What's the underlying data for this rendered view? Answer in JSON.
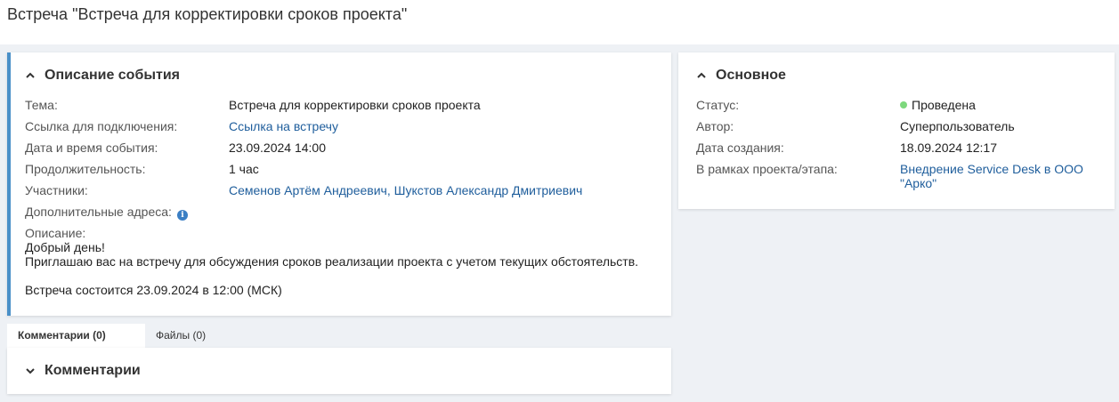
{
  "page": {
    "title": "Встреча \"Встреча для корректировки сроков проекта\""
  },
  "event_card": {
    "header": "Описание события",
    "fields": {
      "topic_label": "Тема:",
      "topic_value": "Встреча для корректировки сроков проекта",
      "link_label": "Ссылка для подключения:",
      "link_value": "Ссылка на встречу",
      "datetime_label": "Дата и время события:",
      "datetime_value": "23.09.2024 14:00",
      "duration_label": "Продолжительность:",
      "duration_value": "1 час",
      "participants_label": "Участники:",
      "participant_1": "Семенов Артём Андреевич",
      "participant_sep": ", ",
      "participant_2": "Шукстов Александр Дмитриевич",
      "extra_addresses_label": "Дополнительные адреса:",
      "description_label": "Описание:"
    },
    "description_lines": [
      "Добрый день!",
      "Приглашаю вас на встречу для обсуждения сроков реализации проекта с учетом текущих обстоятельств.",
      "Встреча состоится 23.09.2024 в 12:00 (МСК)"
    ]
  },
  "main_card": {
    "header": "Основное",
    "status_label": "Статус:",
    "status_value": "Проведена",
    "status_color": "#7dd87d",
    "author_label": "Автор:",
    "author_value": "Суперпользователь",
    "created_label": "Дата создания:",
    "created_value": "18.09.2024 12:17",
    "project_label": "В рамках проекта/этапа:",
    "project_value_line1": "Внедрение Service Desk в ООО",
    "project_value_line2": "\"Арко\""
  },
  "tabs": [
    {
      "label": "Комментарии (0)",
      "active": true
    },
    {
      "label": "Файлы (0)",
      "active": false
    }
  ],
  "comments_card": {
    "header": "Комментарии"
  },
  "colors": {
    "accent": "#4a90c8",
    "link": "#1f5e9c",
    "background": "#eef1f5"
  }
}
